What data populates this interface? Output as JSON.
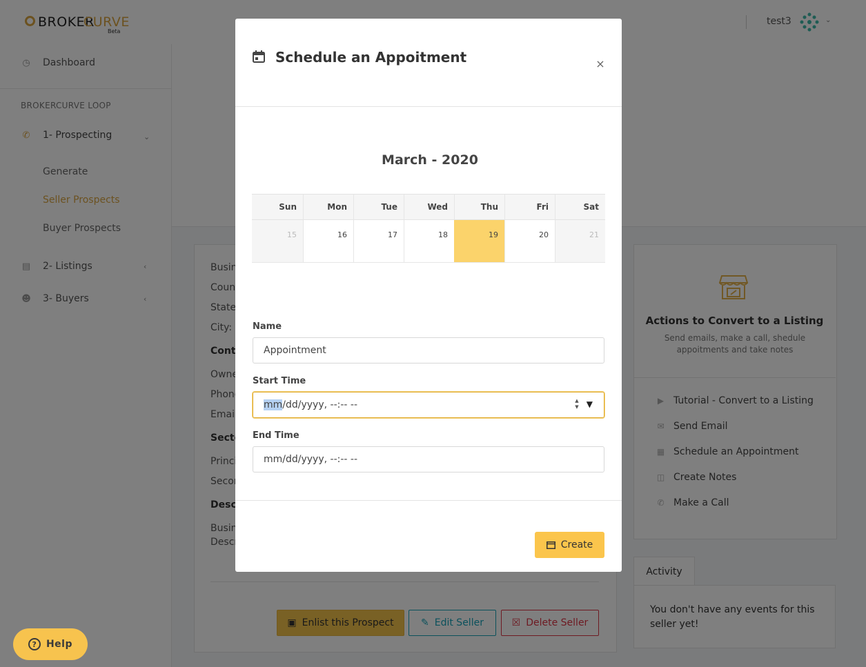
{
  "app": {
    "logo_part1": "BROKER",
    "logo_part2": "CURVE",
    "logo_beta": "Beta",
    "user": "test3",
    "accent": "#d9a441"
  },
  "sidebar": {
    "dashboard": "Dashboard",
    "section": "BROKERCURVE LOOP",
    "prospecting": "1- Prospecting",
    "sub": [
      "Generate",
      "Seller Prospects",
      "Buyer Prospects"
    ],
    "listings": "2- Listings",
    "buyers": "3- Buyers"
  },
  "seller_card": {
    "rows": [
      "Busin",
      "Count",
      "State",
      "City:",
      "Conta",
      "Owne",
      "Phone",
      "Email",
      "Secto",
      "Princi",
      "Secon",
      "Descr",
      "Busin",
      "Descr"
    ],
    "enlist": "Enlist this Prospect",
    "edit": "Edit Seller",
    "delete": "Delete Seller"
  },
  "actions_card": {
    "title": "Actions to Convert to a Listing",
    "subtitle": "Send emails, make a call, shedule appoitments and take notes",
    "items": [
      {
        "label": "Tutorial - Convert to a Listing",
        "icon": "video-icon"
      },
      {
        "label": "Send Email",
        "icon": "envelope-icon"
      },
      {
        "label": "Schedule an Appointment",
        "icon": "calendar-icon"
      },
      {
        "label": "Create Notes",
        "icon": "book-icon"
      },
      {
        "label": "Make a Call",
        "icon": "phone-icon"
      }
    ]
  },
  "activity": {
    "tab": "Activity",
    "empty": "You don't have any events for this seller yet!"
  },
  "help": "Help",
  "modal": {
    "title": "Schedule an Appoitment",
    "close": "×",
    "month": "March - 2020",
    "weekdays": [
      "Sun",
      "Mon",
      "Tue",
      "Wed",
      "Thu",
      "Fri",
      "Sat"
    ],
    "days": [
      "15",
      "16",
      "17",
      "18",
      "19",
      "20",
      "21"
    ],
    "today": "19",
    "name_label": "Name",
    "name_value": "Appointment",
    "start_label": "Start Time",
    "start_sel": "mm",
    "start_rest": "/dd/yyyy, --:-- --",
    "end_label": "End Time",
    "end_value": "mm/dd/yyyy, --:-- --",
    "create": "Create"
  }
}
